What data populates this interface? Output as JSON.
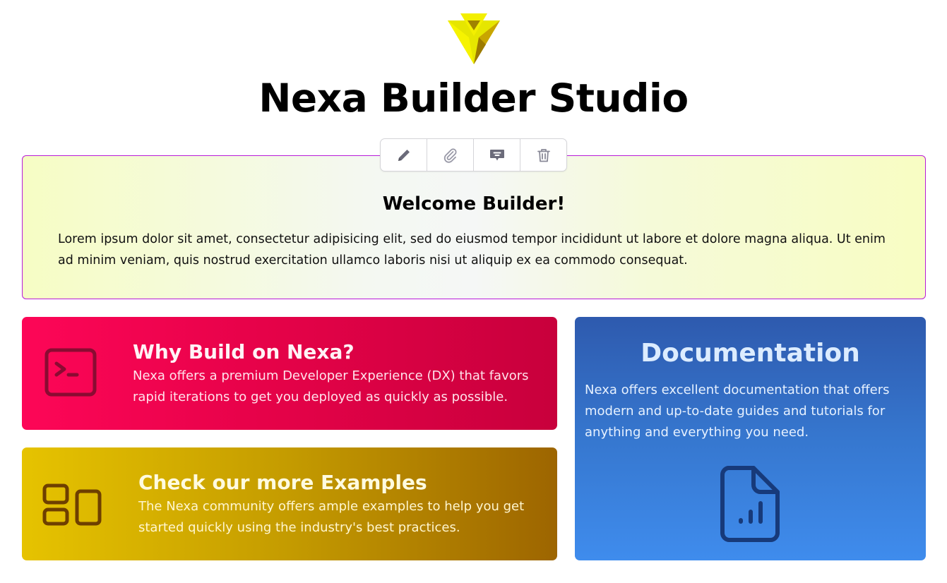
{
  "header": {
    "logo_icon": "nexa-logo-icon",
    "title": "Nexa Builder Studio"
  },
  "toolbar": {
    "buttons": [
      {
        "name": "edit",
        "icon": "pencil-icon"
      },
      {
        "name": "attach",
        "icon": "paperclip-icon"
      },
      {
        "name": "comment",
        "icon": "comment-icon"
      },
      {
        "name": "delete",
        "icon": "trash-icon"
      }
    ]
  },
  "welcome": {
    "title": "Welcome Builder!",
    "body": "Lorem ipsum dolor sit amet, consectetur adipisicing elit, sed do eiusmod tempor incididunt ut labore et dolore magna aliqua. Ut enim ad minim veniam, quis nostrud exercitation ullamco laboris nisi ut aliquip ex ea commodo consequat.",
    "border_color": "#b81bd9"
  },
  "cards": {
    "why": {
      "icon": "terminal-icon",
      "title": "Why Build on Nexa?",
      "text": "Nexa offers a premium Developer Experience (DX) that favors rapid iterations to get you deployed as quickly as possible.",
      "color": "#fd0657"
    },
    "examples": {
      "icon": "layout-grid-icon",
      "title": "Check our more Examples",
      "text": "The Nexa community offers ample examples to help you get started quickly using the industry's best practices.",
      "color": "#e6c300"
    },
    "docs": {
      "icon": "document-chart-icon",
      "title": "Documentation",
      "text": "Nexa offers excellent documentation that offers modern and up-to-date guides and tutorials for anything and everything you need.",
      "color": "#3677cf"
    }
  }
}
